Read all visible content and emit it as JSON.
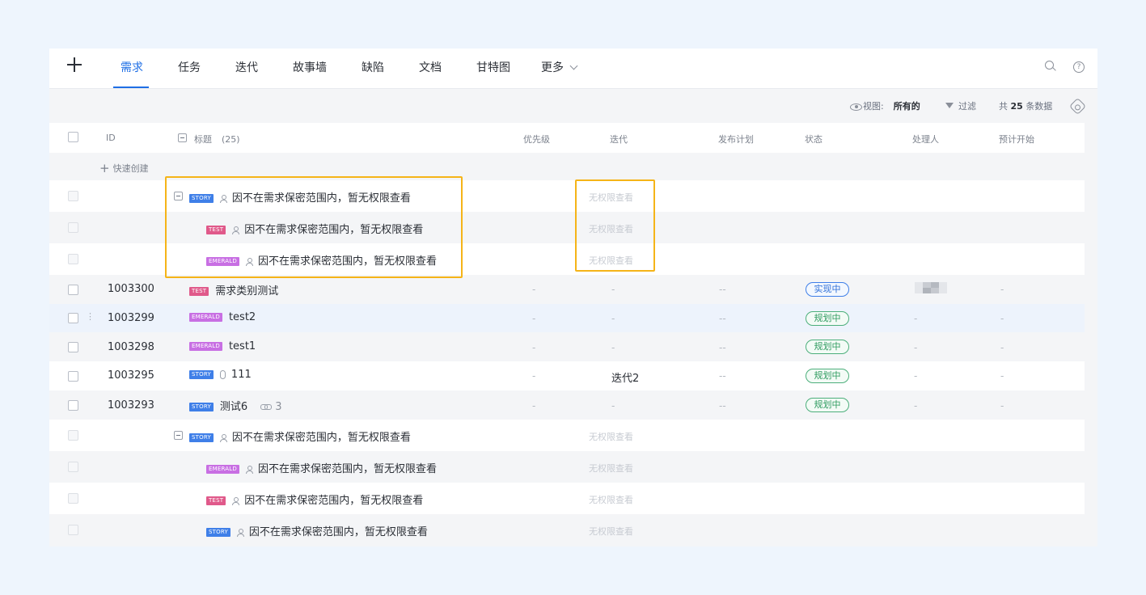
{
  "nav": {
    "tabs": [
      "需求",
      "任务",
      "迭代",
      "故事墙",
      "缺陷",
      "文档",
      "甘特图",
      "更多"
    ],
    "active_tab": "需求"
  },
  "toolbar": {
    "view_label": "视图:",
    "view_value": "所有的",
    "filter_label": "过滤",
    "count_prefix": "共",
    "count": "25",
    "count_suffix": "条数据"
  },
  "table": {
    "headers": {
      "id": "ID",
      "title": "标题",
      "title_count": "(25)",
      "priority": "优先级",
      "iteration": "迭代",
      "release": "发布计划",
      "status": "状态",
      "assignee": "处理人",
      "start": "预计开始"
    },
    "quick_create": "快速创建",
    "no_permission_title": "因不在需求保密范围内，暂无权限查看",
    "no_permission": "无权限查看",
    "rows": [
      {
        "id": "1003300",
        "type": "TEST",
        "title": "需求类别测试",
        "priority": "-",
        "iteration": "-",
        "release": "--",
        "status": "实现中",
        "assignee": "",
        "start": "-"
      },
      {
        "id": "1003299",
        "type": "EMERALD",
        "title": "test2",
        "priority": "-",
        "iteration": "-",
        "release": "--",
        "status": "规划中",
        "assignee": "-",
        "start": "-"
      },
      {
        "id": "1003298",
        "type": "EMERALD",
        "title": "test1",
        "priority": "-",
        "iteration": "-",
        "release": "--",
        "status": "规划中",
        "assignee": "-",
        "start": "-"
      },
      {
        "id": "1003295",
        "type": "STORY",
        "title": "111",
        "priority": "-",
        "iteration": "迭代2",
        "release": "--",
        "status": "规划中",
        "assignee": "-",
        "start": "-"
      },
      {
        "id": "1003293",
        "type": "STORY",
        "title": "测试6",
        "link_count": "3",
        "priority": "-",
        "iteration": "-",
        "release": "--",
        "status": "规划中",
        "assignee": "-",
        "start": "-"
      }
    ],
    "restricted_group_1": [
      "STORY",
      "TEST",
      "EMERALD"
    ],
    "restricted_group_2": [
      "STORY",
      "EMERALD",
      "TEST",
      "STORY"
    ]
  },
  "colors": {
    "accent": "#1f6fe5",
    "highlight": "#f5b418",
    "story": "#3f7fe8",
    "test": "#e0598a",
    "emerald": "#c86fe3"
  }
}
